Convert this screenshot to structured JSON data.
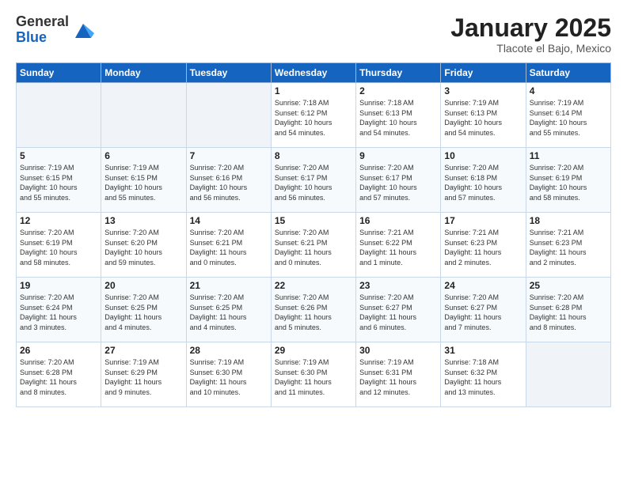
{
  "header": {
    "logo_general": "General",
    "logo_blue": "Blue",
    "month_title": "January 2025",
    "location": "Tlacote el Bajo, Mexico"
  },
  "days_of_week": [
    "Sunday",
    "Monday",
    "Tuesday",
    "Wednesday",
    "Thursday",
    "Friday",
    "Saturday"
  ],
  "weeks": [
    [
      {
        "day": "",
        "info": ""
      },
      {
        "day": "",
        "info": ""
      },
      {
        "day": "",
        "info": ""
      },
      {
        "day": "1",
        "info": "Sunrise: 7:18 AM\nSunset: 6:12 PM\nDaylight: 10 hours\nand 54 minutes."
      },
      {
        "day": "2",
        "info": "Sunrise: 7:18 AM\nSunset: 6:13 PM\nDaylight: 10 hours\nand 54 minutes."
      },
      {
        "day": "3",
        "info": "Sunrise: 7:19 AM\nSunset: 6:13 PM\nDaylight: 10 hours\nand 54 minutes."
      },
      {
        "day": "4",
        "info": "Sunrise: 7:19 AM\nSunset: 6:14 PM\nDaylight: 10 hours\nand 55 minutes."
      }
    ],
    [
      {
        "day": "5",
        "info": "Sunrise: 7:19 AM\nSunset: 6:15 PM\nDaylight: 10 hours\nand 55 minutes."
      },
      {
        "day": "6",
        "info": "Sunrise: 7:19 AM\nSunset: 6:15 PM\nDaylight: 10 hours\nand 55 minutes."
      },
      {
        "day": "7",
        "info": "Sunrise: 7:20 AM\nSunset: 6:16 PM\nDaylight: 10 hours\nand 56 minutes."
      },
      {
        "day": "8",
        "info": "Sunrise: 7:20 AM\nSunset: 6:17 PM\nDaylight: 10 hours\nand 56 minutes."
      },
      {
        "day": "9",
        "info": "Sunrise: 7:20 AM\nSunset: 6:17 PM\nDaylight: 10 hours\nand 57 minutes."
      },
      {
        "day": "10",
        "info": "Sunrise: 7:20 AM\nSunset: 6:18 PM\nDaylight: 10 hours\nand 57 minutes."
      },
      {
        "day": "11",
        "info": "Sunrise: 7:20 AM\nSunset: 6:19 PM\nDaylight: 10 hours\nand 58 minutes."
      }
    ],
    [
      {
        "day": "12",
        "info": "Sunrise: 7:20 AM\nSunset: 6:19 PM\nDaylight: 10 hours\nand 58 minutes."
      },
      {
        "day": "13",
        "info": "Sunrise: 7:20 AM\nSunset: 6:20 PM\nDaylight: 10 hours\nand 59 minutes."
      },
      {
        "day": "14",
        "info": "Sunrise: 7:20 AM\nSunset: 6:21 PM\nDaylight: 11 hours\nand 0 minutes."
      },
      {
        "day": "15",
        "info": "Sunrise: 7:20 AM\nSunset: 6:21 PM\nDaylight: 11 hours\nand 0 minutes."
      },
      {
        "day": "16",
        "info": "Sunrise: 7:21 AM\nSunset: 6:22 PM\nDaylight: 11 hours\nand 1 minute."
      },
      {
        "day": "17",
        "info": "Sunrise: 7:21 AM\nSunset: 6:23 PM\nDaylight: 11 hours\nand 2 minutes."
      },
      {
        "day": "18",
        "info": "Sunrise: 7:21 AM\nSunset: 6:23 PM\nDaylight: 11 hours\nand 2 minutes."
      }
    ],
    [
      {
        "day": "19",
        "info": "Sunrise: 7:20 AM\nSunset: 6:24 PM\nDaylight: 11 hours\nand 3 minutes."
      },
      {
        "day": "20",
        "info": "Sunrise: 7:20 AM\nSunset: 6:25 PM\nDaylight: 11 hours\nand 4 minutes."
      },
      {
        "day": "21",
        "info": "Sunrise: 7:20 AM\nSunset: 6:25 PM\nDaylight: 11 hours\nand 4 minutes."
      },
      {
        "day": "22",
        "info": "Sunrise: 7:20 AM\nSunset: 6:26 PM\nDaylight: 11 hours\nand 5 minutes."
      },
      {
        "day": "23",
        "info": "Sunrise: 7:20 AM\nSunset: 6:27 PM\nDaylight: 11 hours\nand 6 minutes."
      },
      {
        "day": "24",
        "info": "Sunrise: 7:20 AM\nSunset: 6:27 PM\nDaylight: 11 hours\nand 7 minutes."
      },
      {
        "day": "25",
        "info": "Sunrise: 7:20 AM\nSunset: 6:28 PM\nDaylight: 11 hours\nand 8 minutes."
      }
    ],
    [
      {
        "day": "26",
        "info": "Sunrise: 7:20 AM\nSunset: 6:28 PM\nDaylight: 11 hours\nand 8 minutes."
      },
      {
        "day": "27",
        "info": "Sunrise: 7:19 AM\nSunset: 6:29 PM\nDaylight: 11 hours\nand 9 minutes."
      },
      {
        "day": "28",
        "info": "Sunrise: 7:19 AM\nSunset: 6:30 PM\nDaylight: 11 hours\nand 10 minutes."
      },
      {
        "day": "29",
        "info": "Sunrise: 7:19 AM\nSunset: 6:30 PM\nDaylight: 11 hours\nand 11 minutes."
      },
      {
        "day": "30",
        "info": "Sunrise: 7:19 AM\nSunset: 6:31 PM\nDaylight: 11 hours\nand 12 minutes."
      },
      {
        "day": "31",
        "info": "Sunrise: 7:18 AM\nSunset: 6:32 PM\nDaylight: 11 hours\nand 13 minutes."
      },
      {
        "day": "",
        "info": ""
      }
    ]
  ]
}
